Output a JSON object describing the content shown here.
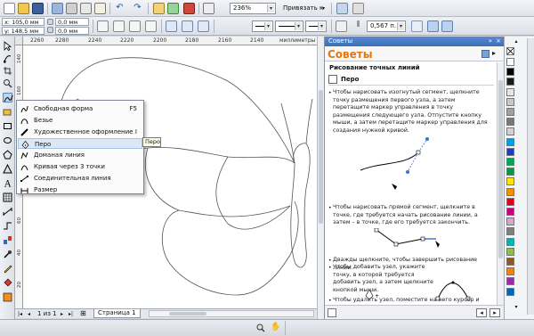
{
  "toolbar": {
    "zoom_value": "236%",
    "snap_label": "Привязать к",
    "outline_width": "0,567 п."
  },
  "property_bar": {
    "x_value": "x: 105,0 мм",
    "y_value": "y: 148,5 мм",
    "w_value": "0,0 мм",
    "h_value": "0,0 мм"
  },
  "ruler": {
    "h_ticks": [
      "2260",
      "2280",
      "2240",
      "2220",
      "2200",
      "2180",
      "2160",
      "2140"
    ],
    "units": "миллиметры",
    "v_ticks": [
      "140",
      "160",
      "120",
      "100",
      "80",
      "60",
      "40",
      "20"
    ]
  },
  "flyout": {
    "items": [
      {
        "label": "Свободная форма",
        "shortcut": "F5"
      },
      {
        "label": "Безье",
        "shortcut": ""
      },
      {
        "label": "Художественное оформление",
        "shortcut": "I"
      },
      {
        "label": "Перо",
        "shortcut": ""
      },
      {
        "label": "Доманая линия",
        "shortcut": ""
      },
      {
        "label": "Кривая через 3 точки",
        "shortcut": ""
      },
      {
        "label": "Соединительная линия",
        "shortcut": ""
      },
      {
        "label": "Размер",
        "shortcut": ""
      }
    ],
    "tooltip": "Перо"
  },
  "pagenav": {
    "counter": "1 из 1",
    "page_tab": "Страница 1"
  },
  "docker": {
    "header": "Советы",
    "title": "Советы",
    "section_title": "Рисование точных линий",
    "tool_name": "Перо",
    "tips": [
      "Чтобы нарисовать изогнутый сегмент, щелкните точку размещения первого узла, а затем перетащите маркер управления в точку размещения следующего узла. Отпустите кнопку мыши, а затем перетащите маркер управления для создания нужной кривой.",
      "Чтобы нарисовать прямой сегмент, щелкните в точке, где требуется начать рисование линии, а затем – в точке, где его требуется закончить.",
      "Дважды щелкните, чтобы завершить рисование линии.",
      "Чтобы добавить узел, укажите точку, в которой требуется добавить узел, а затем щелкните кнопкой мыши.",
      "Чтобы удалить узел, поместите на него курсор и щелкните кнопкой мыши."
    ]
  },
  "colors": {
    "accent_title": "#e07a10",
    "docker_header": "#3a6db9",
    "menu_highlight": "#dbe8f6"
  },
  "palette": [
    "#ffffff",
    "#000000",
    "#1a1a1a",
    "#e6e6e6",
    "#c8c8c8",
    "#a0a0a0",
    "#787878",
    "#d2d2d2",
    "#00a0e0",
    "#1a3cc8",
    "#00a651",
    "#009a44",
    "#ffe600",
    "#f29100",
    "#e2001a",
    "#c8007a",
    "#d4a8c8",
    "#7f7f7f",
    "#00b4b4",
    "#86c440",
    "#8b5a2b",
    "#ff8000",
    "#9a2ca0",
    "#0066b3"
  ]
}
